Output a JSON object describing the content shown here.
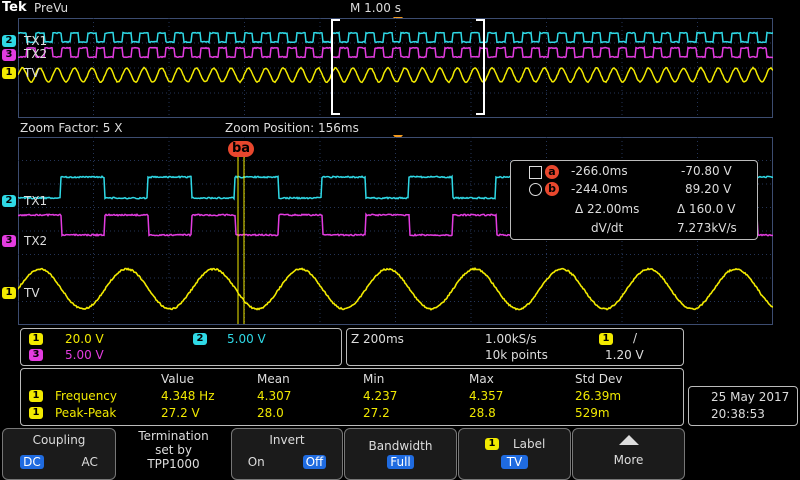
{
  "header": {
    "brand": "Tek",
    "mode": "PreVu",
    "timebase": "M 1.00 s"
  },
  "zoom_header": {
    "factor": "Zoom Factor: 5 X",
    "position": "Zoom Position: 156ms"
  },
  "channels": {
    "ch2": {
      "num": "2",
      "name": "TX1",
      "color": "#2fd9e6"
    },
    "ch3": {
      "num": "3",
      "name": "TX2",
      "color": "#e33ce0"
    },
    "ch1": {
      "num": "1",
      "name": "TV",
      "color": "#f2ea00"
    }
  },
  "cursor_tag": "ba",
  "cursor_readout": {
    "a": {
      "time": "-266.0ms",
      "volt": "-70.80 V"
    },
    "b": {
      "time": "-244.0ms",
      "volt": "89.20 V"
    },
    "delta_time": "Δ 22.00ms",
    "delta_volt": "Δ 160.0 V",
    "dvdt_label": "dV/dt",
    "dvdt_value": "7.273kV/s"
  },
  "scales": {
    "ch1": "20.0 V",
    "ch2": "5.00 V",
    "ch3": "5.00 V"
  },
  "acquisition": {
    "zoom": "Z 200ms",
    "rate": "1.00kS/s",
    "points": "10k points",
    "trigger_ch": "1",
    "trigger_slope": "/",
    "trigger_level": "1.20 V"
  },
  "measurements": {
    "headers": [
      "Value",
      "Mean",
      "Min",
      "Max",
      "Std Dev"
    ],
    "rows": [
      {
        "ch": "1",
        "name": "Frequency",
        "values": [
          "4.348 Hz",
          "4.307",
          "4.237",
          "4.357",
          "26.39m"
        ]
      },
      {
        "ch": "1",
        "name": "Peak-Peak",
        "values": [
          "27.2 V",
          "28.0",
          "27.2",
          "28.8",
          "529m"
        ]
      }
    ]
  },
  "datetime": {
    "date": "25 May 2017",
    "time": "20:38:53"
  },
  "menu": {
    "coupling": {
      "title": "Coupling",
      "opt1": "DC",
      "opt2": "AC"
    },
    "termination": {
      "line1": "Termination",
      "line2": "set by",
      "line3": "TPP1000"
    },
    "invert": {
      "title": "Invert",
      "opt1": "On",
      "opt2": "Off"
    },
    "bandwidth": {
      "title": "Bandwidth",
      "value": "Full"
    },
    "label": {
      "chip": "1",
      "title": "Label",
      "value": "TV"
    },
    "more": {
      "title": "More"
    }
  },
  "colors": {
    "ch1": "#f2ea00",
    "ch2": "#2fd9e6",
    "ch3": "#e33ce0",
    "trigger": "#f39a1e",
    "cursor": "#e8472d",
    "grid": "#3c4c70"
  }
}
